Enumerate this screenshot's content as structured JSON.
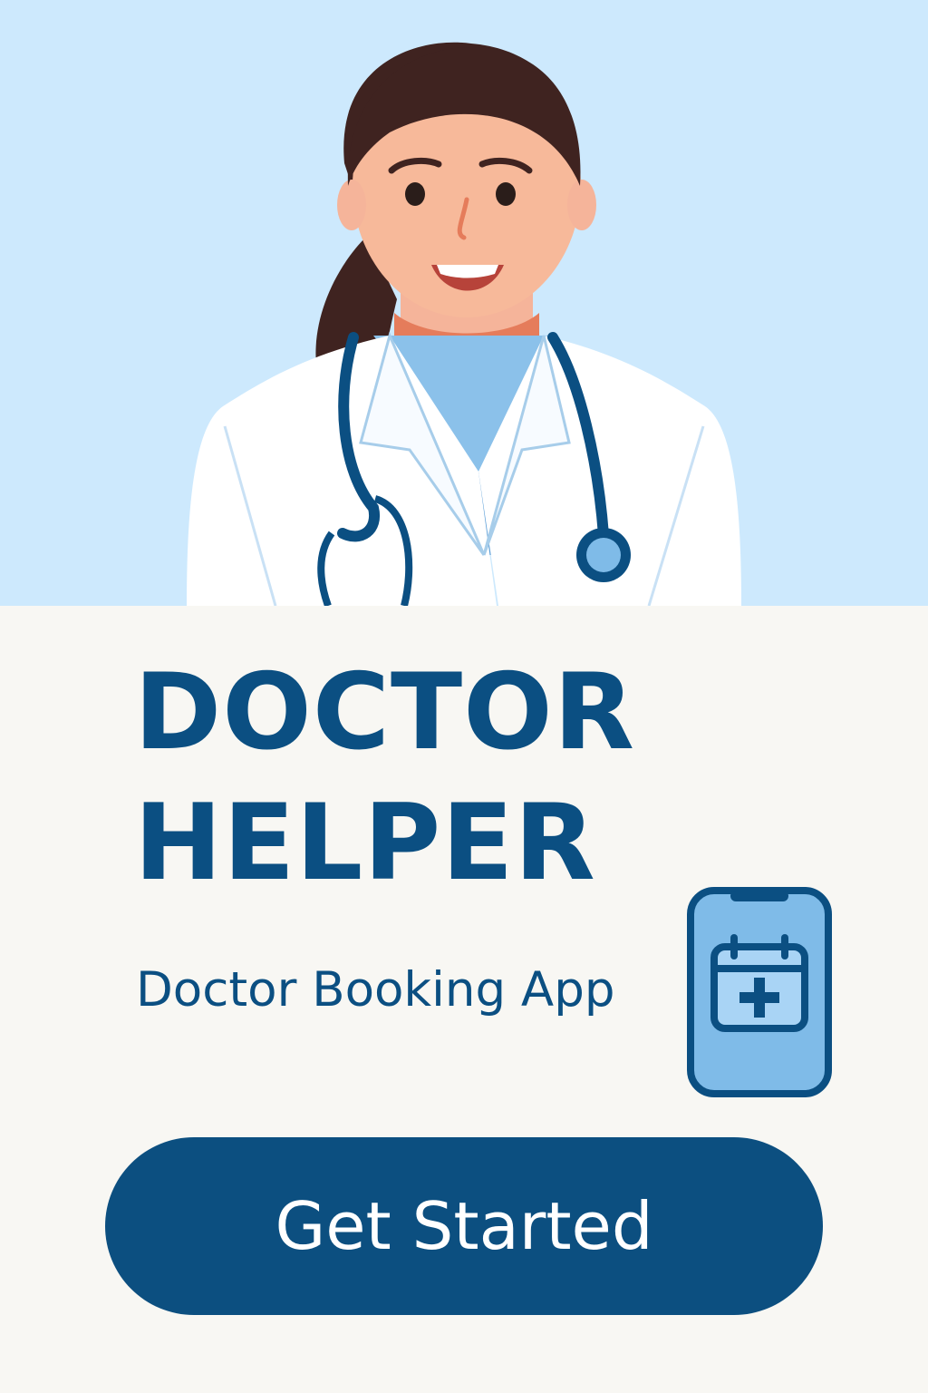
{
  "app": {
    "title_lines": [
      "DOCTOR",
      "HELPER"
    ],
    "subtitle": "Doctor Booking App"
  },
  "cta": {
    "label": "Get Started"
  },
  "icons": {
    "hero": "doctor-illustration",
    "app": "calendar-plus-phone-icon"
  },
  "colors": {
    "primary": "#0b4f82",
    "hero_background": "#cde9fd",
    "page_background": "#f8f7f3",
    "accent_light": "#7fbbe8",
    "skin": "#f7b99a"
  }
}
